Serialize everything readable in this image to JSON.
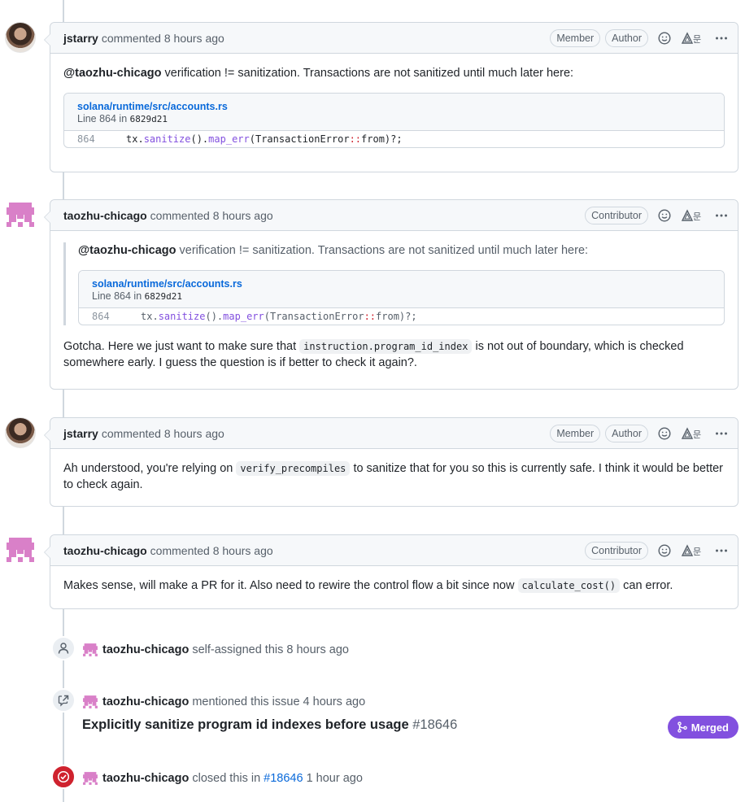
{
  "comments": [
    {
      "author": "jstarry",
      "verb": "commented",
      "time": "8 hours ago",
      "badges": [
        "Member",
        "Author"
      ],
      "avatar": "photo-avatar",
      "mention": "@taozhu-chicago",
      "text": "verification != sanitization. Transactions are not sanitized until much later here:",
      "snippet": {
        "path": "solana/runtime/src/accounts.rs",
        "line_prefix": "Line 864 in",
        "sha": "6829d21",
        "line_number": "864",
        "code": {
          "a": "tx.",
          "b": "sanitize",
          "c": "().",
          "d": "map_err",
          "e": "(TransactionError",
          "f": "::",
          "g": "from)?;"
        }
      }
    },
    {
      "author": "taozhu-chicago",
      "verb": "commented",
      "time": "8 hours ago",
      "badges": [
        "Contributor"
      ],
      "avatar": "identicon-avatar",
      "quote": {
        "mention": "@taozhu-chicago",
        "text": "verification != sanitization. Transactions are not sanitized until much later here:",
        "snippet": {
          "path": "solana/runtime/src/accounts.rs",
          "line_prefix": "Line 864 in",
          "sha": "6829d21",
          "line_number": "864",
          "code": {
            "a": "tx.",
            "b": "sanitize",
            "c": "().",
            "d": "map_err",
            "e": "(TransactionError",
            "f": "::",
            "g": "from)?;"
          }
        }
      },
      "body_before": "Gotcha. Here we just want to make sure that",
      "body_code": "instruction.program_id_index",
      "body_after": "is not out of boundary, which is checked somewhere early. I guess the question is if better to check it again?."
    },
    {
      "author": "jstarry",
      "verb": "commented",
      "time": "8 hours ago",
      "badges": [
        "Member",
        "Author"
      ],
      "avatar": "photo-avatar",
      "body_before": "Ah understood, you're relying on",
      "body_code": "verify_precompiles",
      "body_after": "to sanitize that for you so this is currently safe. I think it would be better to check again."
    },
    {
      "author": "taozhu-chicago",
      "verb": "commented",
      "time": "8 hours ago",
      "badges": [
        "Contributor"
      ],
      "avatar": "identicon-avatar",
      "body_before": "Makes sense, will make a PR for it. Also need to rewire the control flow a bit since now",
      "body_code": "calculate_cost()",
      "body_after": "can error."
    }
  ],
  "events": [
    {
      "icon": "person-icon",
      "actor": "taozhu-chicago",
      "text": "self-assigned this 8 hours ago"
    },
    {
      "icon": "cross-reference-icon",
      "actor": "taozhu-chicago",
      "text": "mentioned this issue 4 hours ago",
      "pr_title": "Explicitly sanitize program id indexes before usage",
      "pr_number": "#18646",
      "pr_status": "Merged"
    },
    {
      "icon": "issue-closed-icon",
      "actor": "taozhu-chicago",
      "text_before": "closed this in",
      "link": "#18646",
      "text_after": "1 hour ago"
    }
  ],
  "colors": {
    "link": "#0969da",
    "merged": "#8250df",
    "closed": "#cf222e",
    "identicon": "#d980c8"
  }
}
